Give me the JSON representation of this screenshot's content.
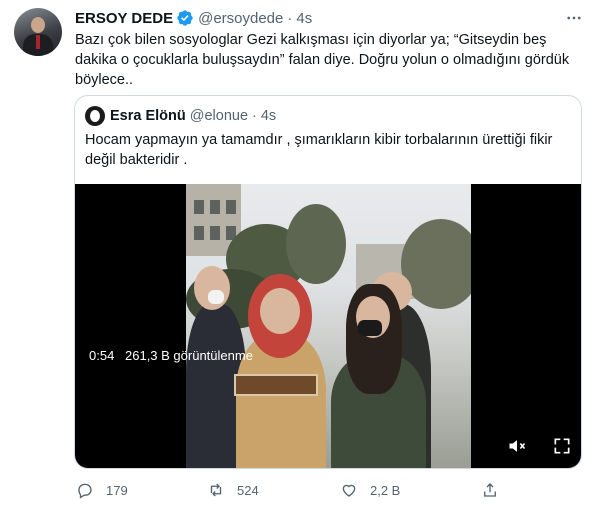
{
  "tweet": {
    "author_name": "ERSOY DEDE",
    "author_handle": "@ersoydede",
    "separator": "·",
    "time": "4s",
    "text": "Bazı çok bilen sosyologlar Gezi kalkışması için diyorlar ya; “Gitseydin beş dakika o çocuklarla buluşsaydın” falan diye. Doğru yolun o olmadığını gördük böylece..",
    "avatar_icon": "profile-photo",
    "verified_icon": "verified-badge-icon",
    "more_icon": "more-options-icon"
  },
  "quote": {
    "author_name": "Esra Elönü",
    "author_handle": "@elonue",
    "separator": "·",
    "time": "4s",
    "text": "Hocam yapmayın ya tamamdır , şımarıkların kibir torbalarının ürettiği fikir değil bakteridir .",
    "video": {
      "duration": "0:54",
      "views": "261,3 B görüntülenme",
      "mute_icon": "mute-icon",
      "fullscreen_icon": "fullscreen-icon"
    }
  },
  "actions": {
    "reply_count": "179",
    "retweet_count": "524",
    "like_count": "2,2 B",
    "share_icon": "share-icon"
  },
  "colors": {
    "text_primary": "#0f1419",
    "text_secondary": "#536471",
    "verified_blue": "#1d9bf0",
    "border": "#cfd9de"
  }
}
